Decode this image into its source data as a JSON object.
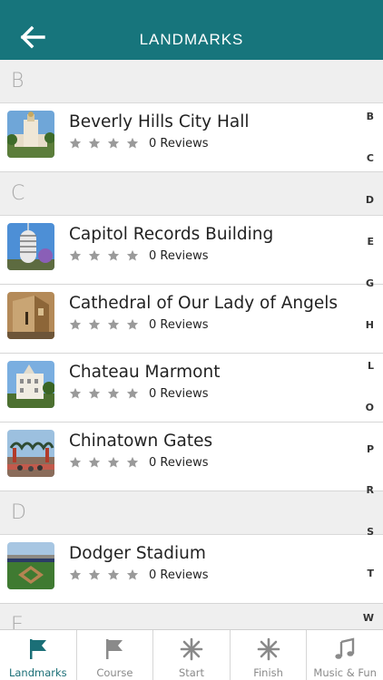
{
  "header": {
    "title": "LANDMARKS",
    "back_icon": "arrow-left-icon"
  },
  "sections": [
    {
      "letter": "B",
      "items": [
        {
          "name": "Beverly Hills City Hall",
          "reviews": "0 Reviews",
          "stars": 0
        }
      ]
    },
    {
      "letter": "C",
      "items": [
        {
          "name": "Capitol Records Building",
          "reviews": "0 Reviews",
          "stars": 0
        },
        {
          "name": "Cathedral of Our Lady of Angels",
          "reviews": "0 Reviews",
          "stars": 0
        },
        {
          "name": "Chateau Marmont",
          "reviews": "0 Reviews",
          "stars": 0
        },
        {
          "name": "Chinatown Gates",
          "reviews": "0 Reviews",
          "stars": 0
        }
      ]
    },
    {
      "letter": "D",
      "items": [
        {
          "name": "Dodger Stadium",
          "reviews": "0 Reviews",
          "stars": 0
        }
      ]
    },
    {
      "letter": "E",
      "items": []
    }
  ],
  "index_letters": [
    "B",
    "C",
    "D",
    "E",
    "G",
    "H",
    "L",
    "O",
    "P",
    "R",
    "S",
    "T",
    "W"
  ],
  "tabs": [
    {
      "label": "Landmarks",
      "icon": "flag-icon",
      "active": true
    },
    {
      "label": "Course",
      "icon": "flag-outline-icon",
      "active": false
    },
    {
      "label": "Start",
      "icon": "asterisk-icon",
      "active": false
    },
    {
      "label": "Finish",
      "icon": "asterisk-icon",
      "active": false
    },
    {
      "label": "Music & Fun",
      "icon": "music-note-icon",
      "active": false
    }
  ],
  "colors": {
    "header": "#17757c",
    "active_tab": "#1b6f77",
    "star": "#9a9a9a"
  }
}
